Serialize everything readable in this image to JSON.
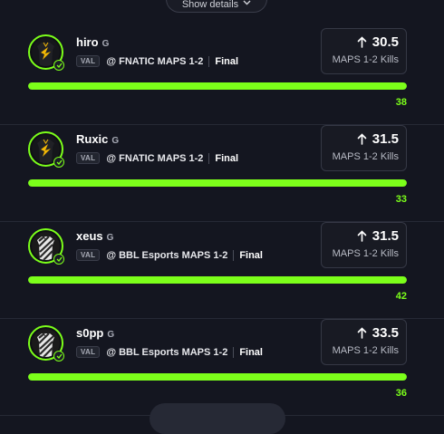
{
  "header": {
    "show_details_label": "Show details"
  },
  "cards": [
    {
      "name": "hiro",
      "position": "G",
      "game_tag": "VAL",
      "match": "@ FNATIC MAPS 1-2",
      "status": "Final",
      "line": "30.5",
      "stat": "MAPS 1-2 Kills",
      "count": "38",
      "progress_pct": 100,
      "jersey": "fnatic"
    },
    {
      "name": "Ruxic",
      "position": "G",
      "game_tag": "VAL",
      "match": "@ FNATIC MAPS 1-2",
      "status": "Final",
      "line": "31.5",
      "stat": "MAPS 1-2 Kills",
      "count": "33",
      "progress_pct": 100,
      "jersey": "fnatic"
    },
    {
      "name": "xeus",
      "position": "G",
      "game_tag": "VAL",
      "match": "@ BBL Esports MAPS 1-2",
      "status": "Final",
      "line": "31.5",
      "stat": "MAPS 1-2 Kills",
      "count": "42",
      "progress_pct": 100,
      "jersey": "bbl"
    },
    {
      "name": "s0pp",
      "position": "G",
      "game_tag": "VAL",
      "match": "@ BBL Esports MAPS 1-2",
      "status": "Final",
      "line": "33.5",
      "stat": "MAPS 1-2 Kills",
      "count": "36",
      "progress_pct": 100,
      "jersey": "bbl"
    }
  ],
  "colors": {
    "accent": "#7cff1a",
    "background": "#141620"
  }
}
